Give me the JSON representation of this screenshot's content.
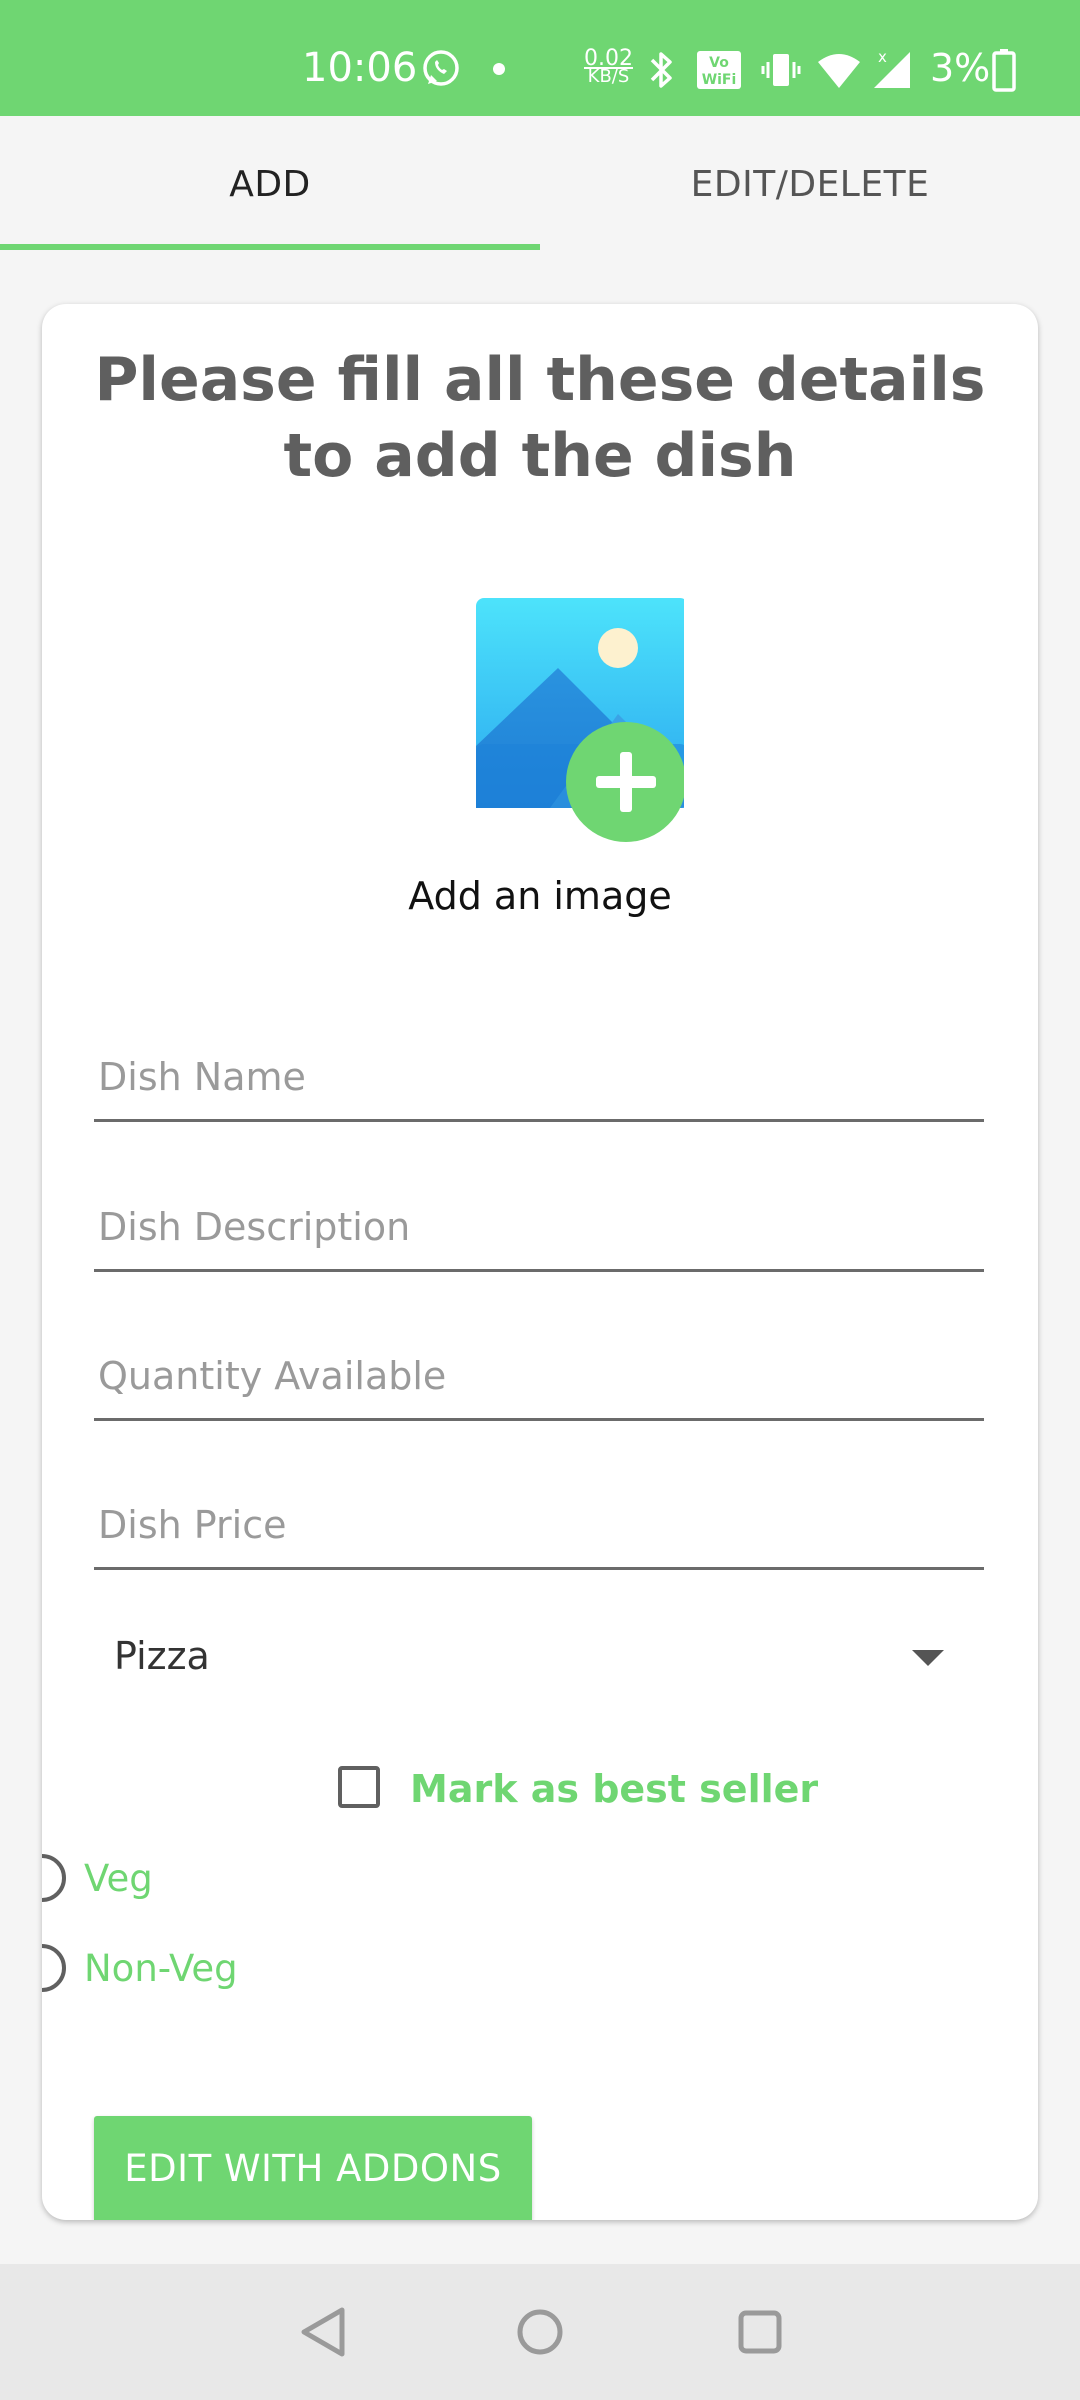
{
  "status_bar": {
    "time": "10:06",
    "net_speed_value": "0.02",
    "net_speed_unit": "KB/S",
    "battery_percent": "3%",
    "icons": [
      "whatsapp-icon",
      "dot-icon",
      "bluetooth-icon",
      "volte-wifi-icon",
      "vibrate-icon",
      "wifi-icon",
      "signal-icon",
      "battery-icon"
    ],
    "background_color": "#6fd672"
  },
  "tabs": [
    {
      "label": "ADD",
      "selected": true
    },
    {
      "label": "EDIT/DELETE",
      "selected": false
    }
  ],
  "form": {
    "title": "Please fill all these details to add the dish",
    "image_picker_label": "Add an image",
    "fields": {
      "dish_name": {
        "placeholder": "Dish Name",
        "value": ""
      },
      "dish_description": {
        "placeholder": "Dish Description",
        "value": ""
      },
      "quantity": {
        "placeholder": "Quantity Available",
        "value": ""
      },
      "price": {
        "placeholder": "Dish Price",
        "value": ""
      }
    },
    "category": {
      "selected": "Pizza"
    },
    "best_seller": {
      "label": "Mark as best seller",
      "checked": false
    },
    "type_options": [
      {
        "label": "Veg",
        "checked": false
      },
      {
        "label": "Non-Veg",
        "checked": false
      }
    ],
    "addons_button": "EDIT WITH ADDONS"
  },
  "nav_bar": {
    "buttons": [
      "back-icon",
      "home-icon",
      "recents-icon"
    ]
  },
  "colors": {
    "accent": "#6fd672",
    "title_text": "#5f5f5f",
    "nav_bar": "#e8e8e8"
  }
}
